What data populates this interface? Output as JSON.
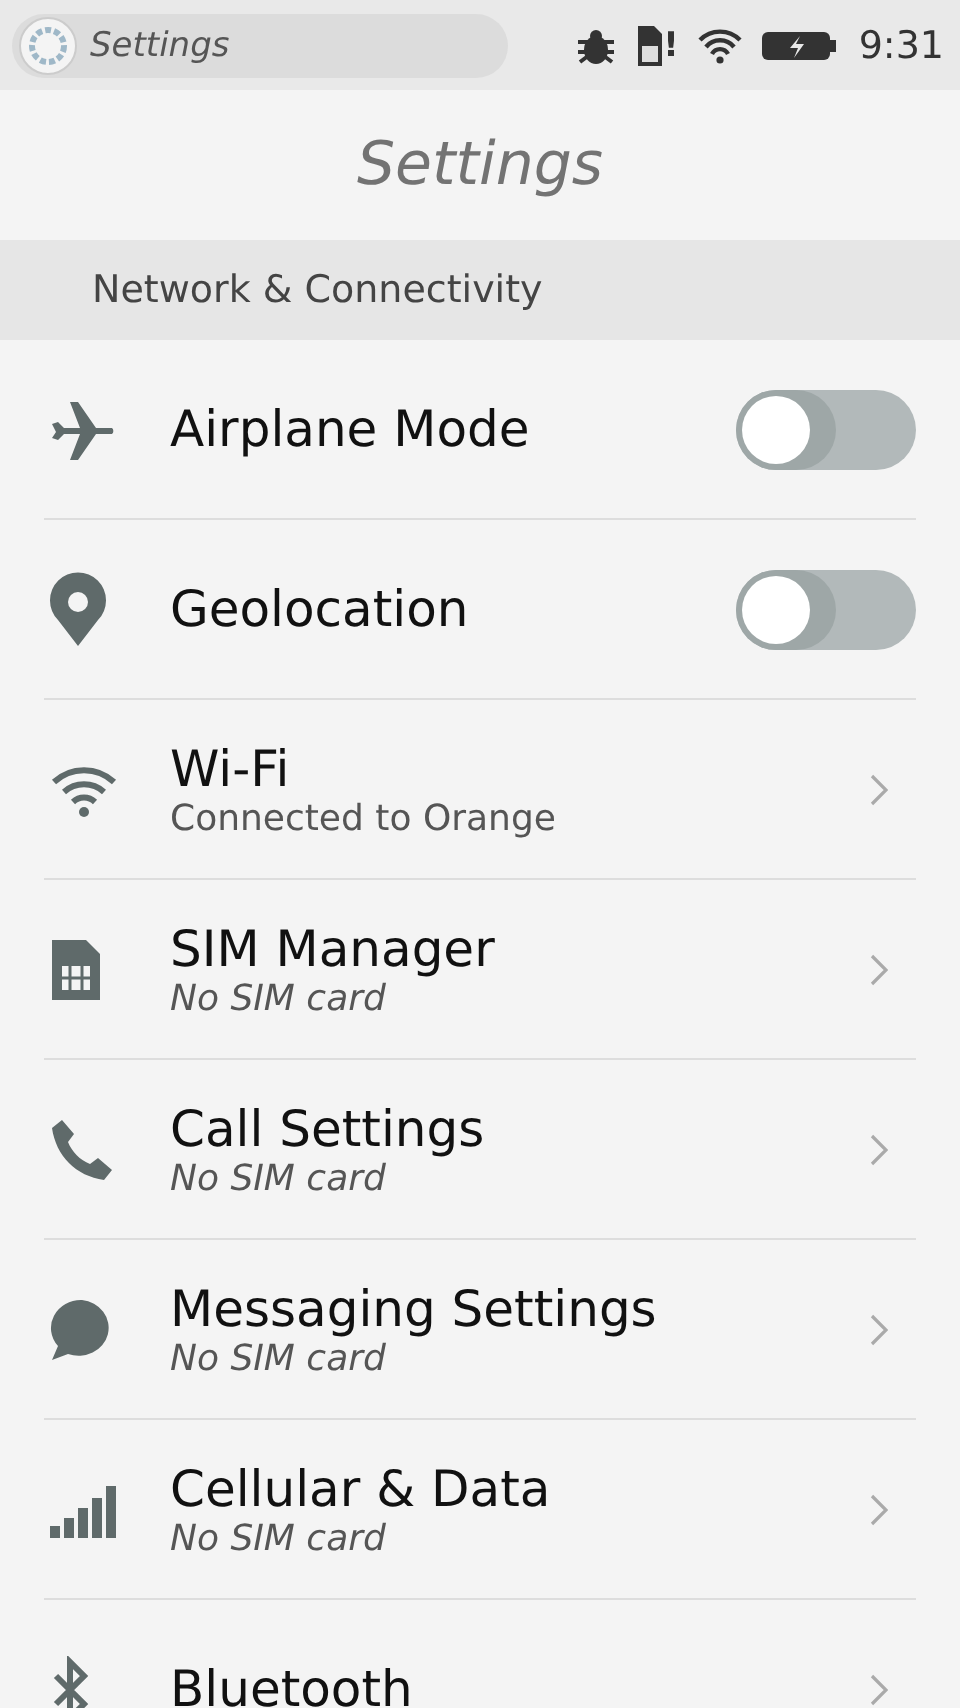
{
  "status_bar": {
    "app_title": "Settings",
    "sim_alert": "!",
    "time": "9:31"
  },
  "header": {
    "title": "Settings"
  },
  "section": {
    "title": "Network & Connectivity"
  },
  "items": [
    {
      "kind": "toggle",
      "label": "Airplane Mode",
      "on": false
    },
    {
      "kind": "toggle",
      "label": "Geolocation",
      "on": false
    },
    {
      "kind": "link",
      "label": "Wi-Fi",
      "subtitle": "Connected to Orange",
      "italic": false
    },
    {
      "kind": "link",
      "label": "SIM Manager",
      "subtitle": "No SIM card",
      "italic": true
    },
    {
      "kind": "link",
      "label": "Call Settings",
      "subtitle": "No SIM card",
      "italic": true
    },
    {
      "kind": "link",
      "label": "Messaging Settings",
      "subtitle": "No SIM card",
      "italic": true
    },
    {
      "kind": "link",
      "label": "Cellular & Data",
      "subtitle": "No SIM card",
      "italic": true
    },
    {
      "kind": "link",
      "label": "Bluetooth"
    }
  ]
}
